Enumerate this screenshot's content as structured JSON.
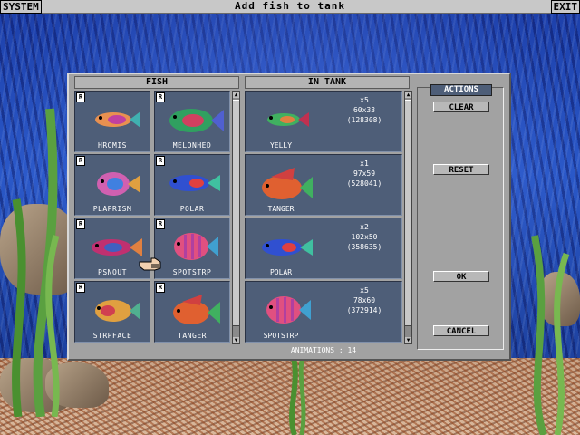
{
  "titlebar": {
    "system": "SYSTEM",
    "title": "Add fish to tank",
    "exit": "EXIT"
  },
  "fish_panel": {
    "header": "FISH",
    "items": [
      {
        "name": "HROMIS",
        "badge": "R",
        "colors": [
          "#e89050",
          "#c040a0",
          "#40b0b0"
        ]
      },
      {
        "name": "MELONHED",
        "badge": "R",
        "colors": [
          "#30a060",
          "#d04060",
          "#5060d0"
        ]
      },
      {
        "name": "PLAPRISM",
        "badge": "R",
        "colors": [
          "#d060b0",
          "#4080e0",
          "#e0a040"
        ]
      },
      {
        "name": "POLAR",
        "badge": "R",
        "colors": [
          "#3050d0",
          "#e04040",
          "#40c0a0"
        ]
      },
      {
        "name": "PSNOUT",
        "badge": "R",
        "colors": [
          "#c03070",
          "#4060c0",
          "#e08040"
        ]
      },
      {
        "name": "SPOTSTRP",
        "badge": "R",
        "colors": [
          "#e05080",
          "#b040a0",
          "#40a0d0"
        ]
      },
      {
        "name": "STRPFACE",
        "badge": "R",
        "colors": [
          "#e0a040",
          "#d04050",
          "#50b090"
        ]
      },
      {
        "name": "TANGER",
        "badge": "R",
        "colors": [
          "#e06030",
          "#d04040",
          "#40b060"
        ]
      }
    ]
  },
  "tank_panel": {
    "header": "IN TANK",
    "items": [
      {
        "name": "YELLY",
        "count": "x5",
        "size": "60x33",
        "bytes": "(128308)",
        "colors": [
          "#40b060",
          "#e08040",
          "#c03050"
        ]
      },
      {
        "name": "TANGER",
        "count": "x1",
        "size": "97x59",
        "bytes": "(528041)",
        "colors": [
          "#e06030",
          "#d04040",
          "#40b060"
        ]
      },
      {
        "name": "POLAR",
        "count": "x2",
        "size": "102x50",
        "bytes": "(358635)",
        "colors": [
          "#3050d0",
          "#e04040",
          "#40c0a0"
        ]
      },
      {
        "name": "SPOTSTRP",
        "count": "x5",
        "size": "78x60",
        "bytes": "(372914)",
        "colors": [
          "#e05080",
          "#b040a0",
          "#40a0d0"
        ]
      }
    ],
    "animations": "ANIMATIONS : 14"
  },
  "actions": {
    "title": "ACTIONS",
    "clear": "CLEAR",
    "reset": "RESET",
    "ok": "OK",
    "cancel": "CANCEL"
  }
}
